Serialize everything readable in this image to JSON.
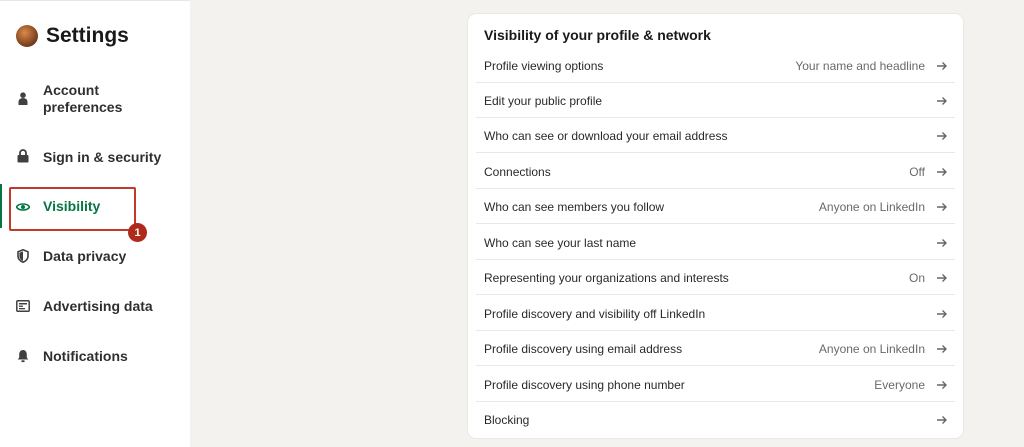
{
  "sidebar": {
    "title": "Settings",
    "items": [
      {
        "label_line1": "Account",
        "label_line2": "preferences",
        "icon": "person-icon"
      },
      {
        "label": "Sign in & security",
        "icon": "lock-icon"
      },
      {
        "label": "Visibility",
        "icon": "eye-icon",
        "active": true
      },
      {
        "label": "Data privacy",
        "icon": "shield-icon"
      },
      {
        "label": "Advertising data",
        "icon": "newspaper-icon"
      },
      {
        "label": "Notifications",
        "icon": "bell-icon"
      }
    ],
    "step_badge": "1"
  },
  "main": {
    "section_title": "Visibility of your profile & network",
    "rows": [
      {
        "label": "Profile viewing options",
        "value": "Your name and headline"
      },
      {
        "label": "Edit your public profile",
        "value": ""
      },
      {
        "label": "Who can see or download your email address",
        "value": ""
      },
      {
        "label": "Connections",
        "value": "Off"
      },
      {
        "label": "Who can see members you follow",
        "value": "Anyone on LinkedIn"
      },
      {
        "label": "Who can see your last name",
        "value": ""
      },
      {
        "label": "Representing your organizations and interests",
        "value": "On"
      },
      {
        "label": "Profile discovery and visibility off LinkedIn",
        "value": ""
      },
      {
        "label": "Profile discovery using email address",
        "value": "Anyone on LinkedIn"
      },
      {
        "label": "Profile discovery using phone number",
        "value": "Everyone"
      },
      {
        "label": "Blocking",
        "value": ""
      }
    ]
  },
  "colors": {
    "accent_green": "#057642",
    "annotation_red": "#c0392b",
    "page_background": "#f3f2ef"
  }
}
